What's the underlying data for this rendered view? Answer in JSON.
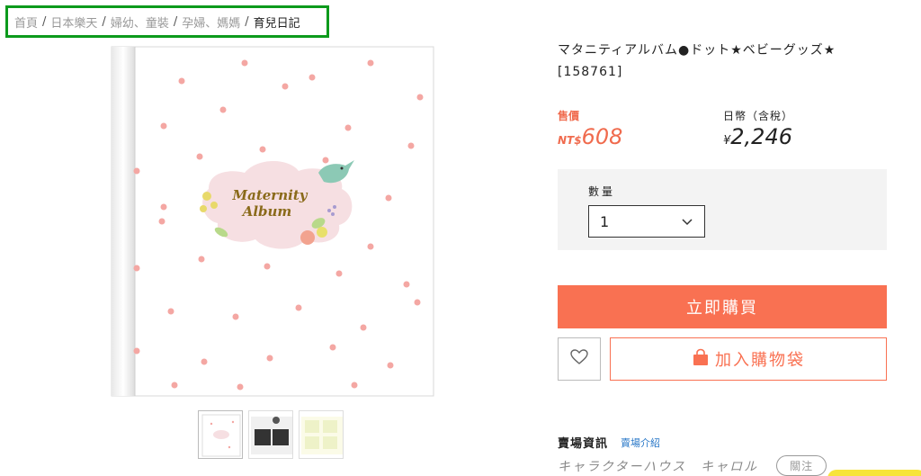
{
  "breadcrumb": [
    {
      "label": "首頁"
    },
    {
      "label": "日本樂天"
    },
    {
      "label": "婦幼、童裝"
    },
    {
      "label": "孕婦、媽媽"
    },
    {
      "label": "育兒日記"
    }
  ],
  "product": {
    "title_line1": "マタニティアルバム●ドット★ベビーグッズ★",
    "title_line2": "[158761]",
    "cover_text_line1": "Maternity",
    "cover_text_line2": "Album"
  },
  "price": {
    "label": "售價",
    "currency": "NT$",
    "value": "608"
  },
  "yen": {
    "label": "日幣（含稅）",
    "currency": "¥",
    "value": "2,246"
  },
  "quantity": {
    "label": "數量",
    "selected": "1"
  },
  "actions": {
    "buy_label": "立即購買",
    "cart_label": "加入購物袋"
  },
  "shop": {
    "title": "賣場資訊",
    "link": "賣場介紹",
    "name": "キャラクターハウス　キャロル",
    "follow_label": "關注"
  },
  "colors": {
    "accent": "#f97152",
    "price": "#f06b4e",
    "breadcrumb_border": "#0c9a1c",
    "link": "#2a78c8"
  },
  "icons": [
    "chevron-down-icon",
    "heart-icon",
    "shopping-bag-icon"
  ]
}
